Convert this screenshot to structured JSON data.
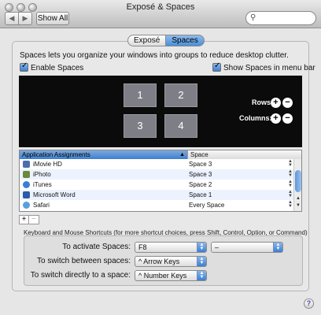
{
  "window": {
    "title": "Exposé & Spaces"
  },
  "toolbar": {
    "back_symbol": "◀",
    "forward_symbol": "▶",
    "show_all_label": "Show All",
    "search_placeholder": "",
    "search_value": ""
  },
  "tabs": [
    {
      "label": "Exposé",
      "selected": false
    },
    {
      "label": "Spaces",
      "selected": true
    }
  ],
  "intro_text": "Spaces lets you organize your windows into groups to reduce desktop clutter.",
  "enable_spaces": {
    "label": "Enable Spaces",
    "checked": true
  },
  "show_in_menubar": {
    "label": "Show Spaces in menu bar",
    "checked": true
  },
  "spaces": [
    "1",
    "2",
    "3",
    "4"
  ],
  "rows_label": "Rows:",
  "columns_label": "Columns:",
  "table": {
    "headers": [
      "Application Assignments",
      "Space"
    ],
    "rows": [
      {
        "app": "iMovie HD",
        "space": "Space 3",
        "icon": "imovie-icon",
        "icon_color": "#4a6fb0"
      },
      {
        "app": "iPhoto",
        "space": "Space 3",
        "icon": "iphoto-icon",
        "icon_color": "#6b8a3a"
      },
      {
        "app": "iTunes",
        "space": "Space 2",
        "icon": "itunes-icon",
        "icon_color": "#3a7fd5"
      },
      {
        "app": "Microsoft Word",
        "space": "Space 1",
        "icon": "word-icon",
        "icon_color": "#2b5aa8"
      },
      {
        "app": "Safari",
        "space": "Every Space",
        "icon": "safari-icon",
        "icon_color": "#5a9ee0"
      }
    ]
  },
  "add_button": "+",
  "remove_button": "−",
  "shortcuts_hint": "Keyboard and Mouse Shortcuts (for more shortcut choices, press Shift, Control, Option, or Command)",
  "shortcuts": {
    "activate_label": "To activate Spaces:",
    "activate_value": "F8",
    "activate_modifier": "–",
    "switch_label": "To switch between spaces:",
    "switch_value": "^ Arrow Keys",
    "direct_label": "To switch directly to a space:",
    "direct_value": "^ Number Keys"
  },
  "help_symbol": "?",
  "colors": {
    "accent": "#3d7fd0",
    "spaces_background": "#0b0b0b",
    "space_tile": "#7e7f86"
  }
}
